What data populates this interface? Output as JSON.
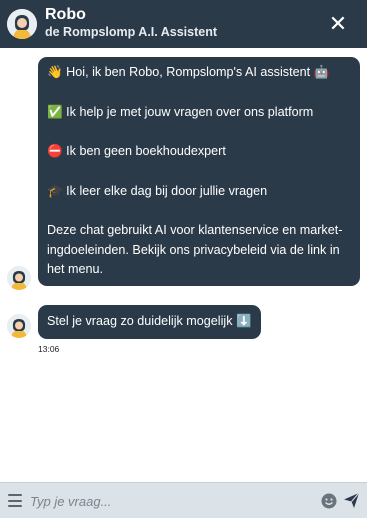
{
  "header": {
    "title": "Robo",
    "subtitle": "de Rompslomp A.I. Assistent",
    "close_symbol": "✕",
    "avatar_icon": "robo-avatar-icon",
    "close_icon": "close-icon"
  },
  "messages": [
    {
      "lines": [
        "👋 Hoi, ik ben Robo, Rompslomp's AI assistent 🤖",
        "✅ Ik help je met jouw vragen over ons platform",
        "⛔ Ik ben geen boekhoudexpert",
        "🎓 Ik leer elke dag bij door jullie vragen",
        "Deze chat gebruikt AI voor klantenservice en market-ingdoeleinden. Bekijk ons privacybeleid via de link in het menu."
      ]
    },
    {
      "text": "Stel je vraag zo duidelijk mogelijk ⬇️",
      "timestamp": "13:06"
    }
  ],
  "composer": {
    "placeholder": "Typ je vraag...",
    "menu_icon": "menu-icon",
    "emoji_icon": "emoji-icon",
    "send_icon": "send-icon"
  },
  "colors": {
    "header_bg": "#2b3a48",
    "bubble_bg": "#2b3a48",
    "footer_bg": "#dbe2e8"
  }
}
